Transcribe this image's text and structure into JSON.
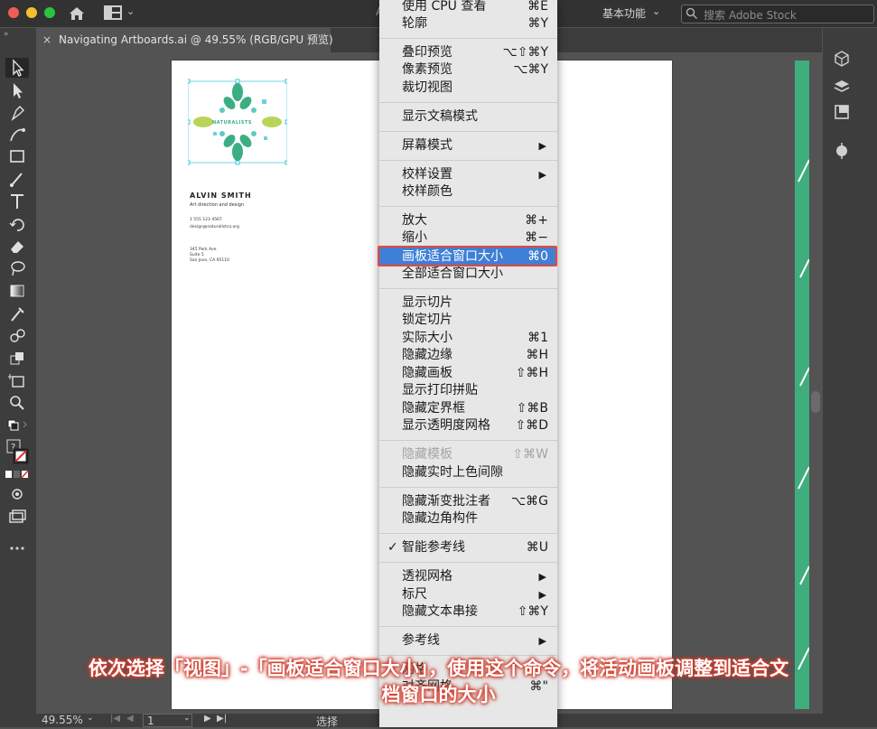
{
  "app": {
    "window_controls": {
      "close_color": "#ee5e57",
      "minimize_color": "#f5be2e",
      "zoom_color": "#2bc441"
    },
    "top_mid_letter": "A",
    "workspace_label": "基本功能",
    "search_placeholder": "搜索 Adobe Stock"
  },
  "document": {
    "tab_close": "×",
    "tab_title": "Navigating Artboards.ai @ 49.55% (RGB/GPU 预览)"
  },
  "artboard": {
    "logo_text": "NATURALISTS",
    "name": "ALVIN SMITH",
    "role": "Art direction and design",
    "phone": "1 555 123 4567",
    "email": "design@naturalistco.org",
    "address_line1": "345 Park Ave.",
    "address_line2": "Suite 5",
    "address_line3": "San Jose, CA 95110"
  },
  "status": {
    "zoom": "49.55%",
    "page": "1",
    "tool_label": "选择"
  },
  "menu": {
    "items": [
      {
        "label": "使用 CPU 查看",
        "shortcut": "⌘E"
      },
      {
        "label": "轮廓",
        "shortcut": "⌘Y"
      },
      {
        "label": "叠印预览",
        "shortcut": "⌥⇧⌘Y"
      },
      {
        "label": "像素预览",
        "shortcut": "⌥⌘Y"
      },
      {
        "label": "裁切视图",
        "shortcut": ""
      },
      {
        "label": "显示文稿模式",
        "shortcut": ""
      },
      {
        "label": "屏幕模式",
        "shortcut": "▶"
      },
      {
        "label": "校样设置",
        "shortcut": "▶"
      },
      {
        "label": "校样颜色",
        "shortcut": ""
      },
      {
        "label": "放大",
        "shortcut": "⌘+"
      },
      {
        "label": "缩小",
        "shortcut": "⌘−"
      },
      {
        "label": "画板适合窗口大小",
        "shortcut": "⌘0"
      },
      {
        "label": "全部适合窗口大小",
        "shortcut": ""
      },
      {
        "label": "显示切片",
        "shortcut": ""
      },
      {
        "label": "锁定切片",
        "shortcut": ""
      },
      {
        "label": "实际大小",
        "shortcut": "⌘1"
      },
      {
        "label": "隐藏边缘",
        "shortcut": "⌘H"
      },
      {
        "label": "隐藏画板",
        "shortcut": "⇧⌘H"
      },
      {
        "label": "显示打印拼贴",
        "shortcut": ""
      },
      {
        "label": "隐藏定界框",
        "shortcut": "⇧⌘B"
      },
      {
        "label": "显示透明度网格",
        "shortcut": "⇧⌘D"
      },
      {
        "label": "隐藏模板",
        "shortcut": "⇧⌘W"
      },
      {
        "label": "隐藏实时上色间隙",
        "shortcut": ""
      },
      {
        "label": "隐藏渐变批注者",
        "shortcut": "⌥⌘G"
      },
      {
        "label": "隐藏边角构件",
        "shortcut": ""
      },
      {
        "label": "智能参考线",
        "shortcut": "⌘U",
        "check": "✓"
      },
      {
        "label": "透视网格",
        "shortcut": "▶"
      },
      {
        "label": "标尺",
        "shortcut": "▶"
      },
      {
        "label": "隐藏文本串接",
        "shortcut": "⇧⌘Y"
      },
      {
        "label": "参考线",
        "shortcut": "▶"
      },
      {
        "label": "网格",
        "shortcut": ""
      },
      {
        "label": "对齐网格",
        "shortcut": "⌘\""
      }
    ],
    "highlight_color": "#3f7fd6",
    "annotation_border_color": "#e8473a"
  },
  "caption": {
    "line1": "依次选择「视图」-「画板适合窗口大小」，使用这个命令，将活动画板调整到适合文",
    "line2": "档窗口的大小"
  }
}
